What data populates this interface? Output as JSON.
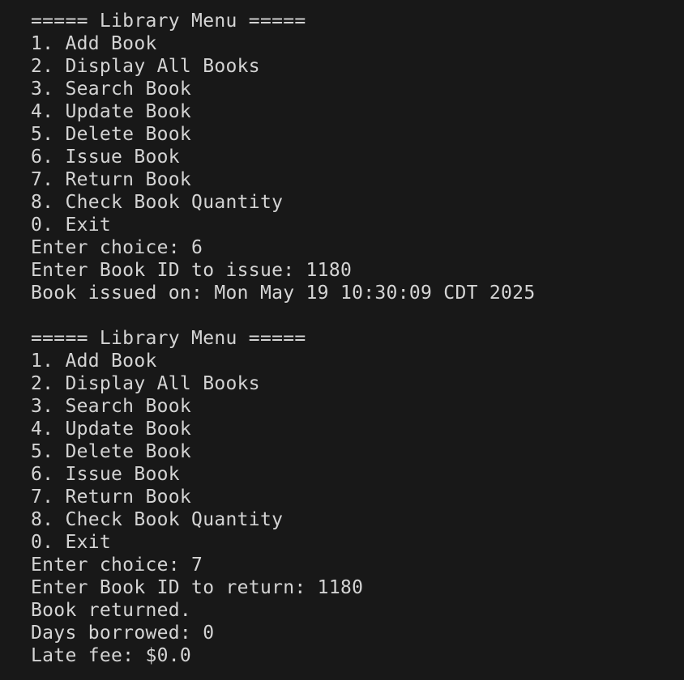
{
  "terminal": {
    "session1": {
      "header": "===== Library Menu =====",
      "items": [
        "1. Add Book",
        "2. Display All Books",
        "3. Search Book",
        "4. Update Book",
        "5. Delete Book",
        "6. Issue Book",
        "7. Return Book",
        "8. Check Book Quantity",
        "0. Exit"
      ],
      "choice_prompt": "Enter choice: 6",
      "id_prompt": "Enter Book ID to issue: 1180",
      "result": "Book issued on: Mon May 19 10:30:09 CDT 2025"
    },
    "session2": {
      "header": "===== Library Menu =====",
      "items": [
        "1. Add Book",
        "2. Display All Books",
        "3. Search Book",
        "4. Update Book",
        "5. Delete Book",
        "6. Issue Book",
        "7. Return Book",
        "8. Check Book Quantity",
        "0. Exit"
      ],
      "choice_prompt": "Enter choice: 7",
      "id_prompt": "Enter Book ID to return: 1180",
      "result_lines": [
        "Book returned.",
        "Days borrowed: 0",
        "Late fee: $0.0"
      ]
    }
  }
}
